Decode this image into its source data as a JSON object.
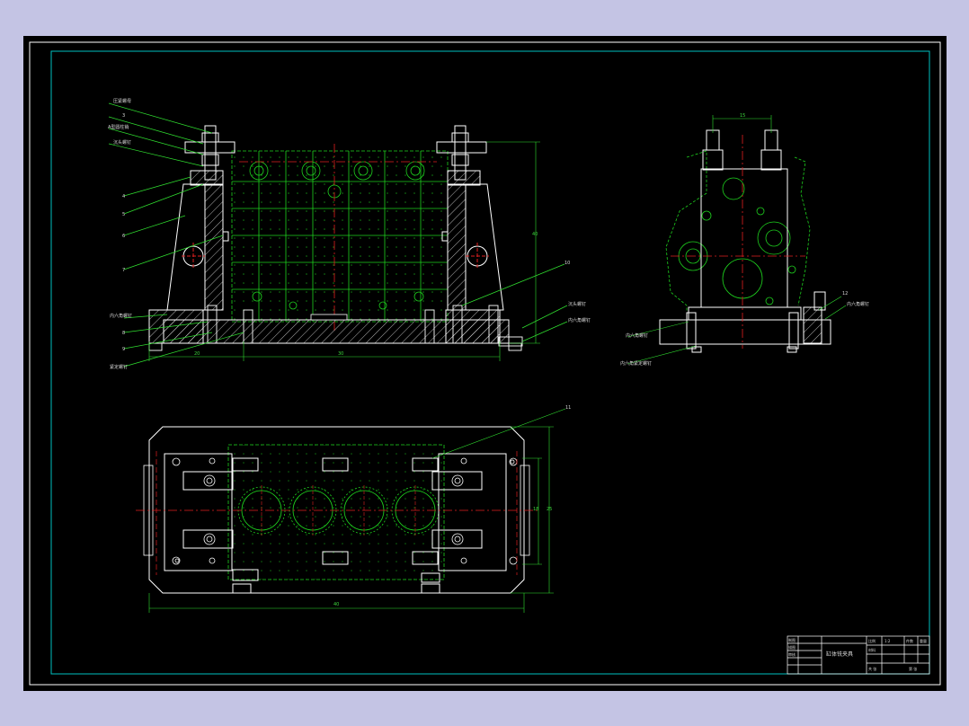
{
  "colors": {
    "background": "#000000",
    "outer_border": "#ffffff",
    "inner_border": "#00c0c0",
    "part_outline": "#ffffff",
    "workpiece": "#1ed21e",
    "centerline": "#e02020",
    "dimension": "#30e030",
    "hatch": "#ffffff"
  },
  "front_view": {
    "leader_labels": [
      "压紧螺母",
      "3",
      "A型圆柱销",
      "沉头螺钉",
      "4",
      "5",
      "6",
      "7",
      "内六角螺钉",
      "8",
      "9",
      "紧定螺钉"
    ],
    "right_labels": [
      "10",
      "沉头螺钉",
      "内六角螺钉"
    ],
    "dims": {
      "height": "40",
      "width_left": "20",
      "width_main": "30"
    }
  },
  "side_view": {
    "dim_top": "15",
    "labels": [
      "12",
      "内六角螺钉",
      "内六角螺钉",
      "内六角紧定螺钉"
    ]
  },
  "top_view": {
    "leader_label": "11",
    "dims": {
      "overall_width": "40",
      "height": "25",
      "inner_height": "18"
    }
  },
  "title_block": {
    "drawing_name": "缸体铣夹具",
    "cells": [
      "比例",
      "1:2",
      "件数",
      "重量",
      "共 张",
      "第 张",
      "制图",
      "描图",
      "审核",
      "材料"
    ]
  }
}
